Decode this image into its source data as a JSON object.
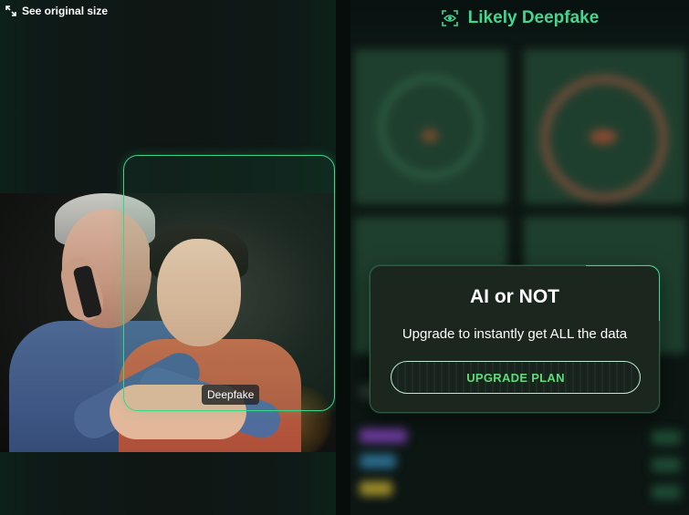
{
  "left_panel": {
    "see_original_label": "See original size",
    "detection_label": "Deepfake"
  },
  "right_panel": {
    "verdict_label": "Likely Deepfake",
    "upgrade_card": {
      "title": "AI or NOT",
      "subtitle": "Upgrade to instantly get ALL the data",
      "button_label": "UPGRADE PLAN"
    }
  },
  "icons": {
    "see_original": "expand-icon",
    "verdict": "eye-scan-icon"
  },
  "colors": {
    "accent_green": "#44d68e",
    "detect_box": "#3ed38a",
    "button_text": "#5fdc7a"
  }
}
